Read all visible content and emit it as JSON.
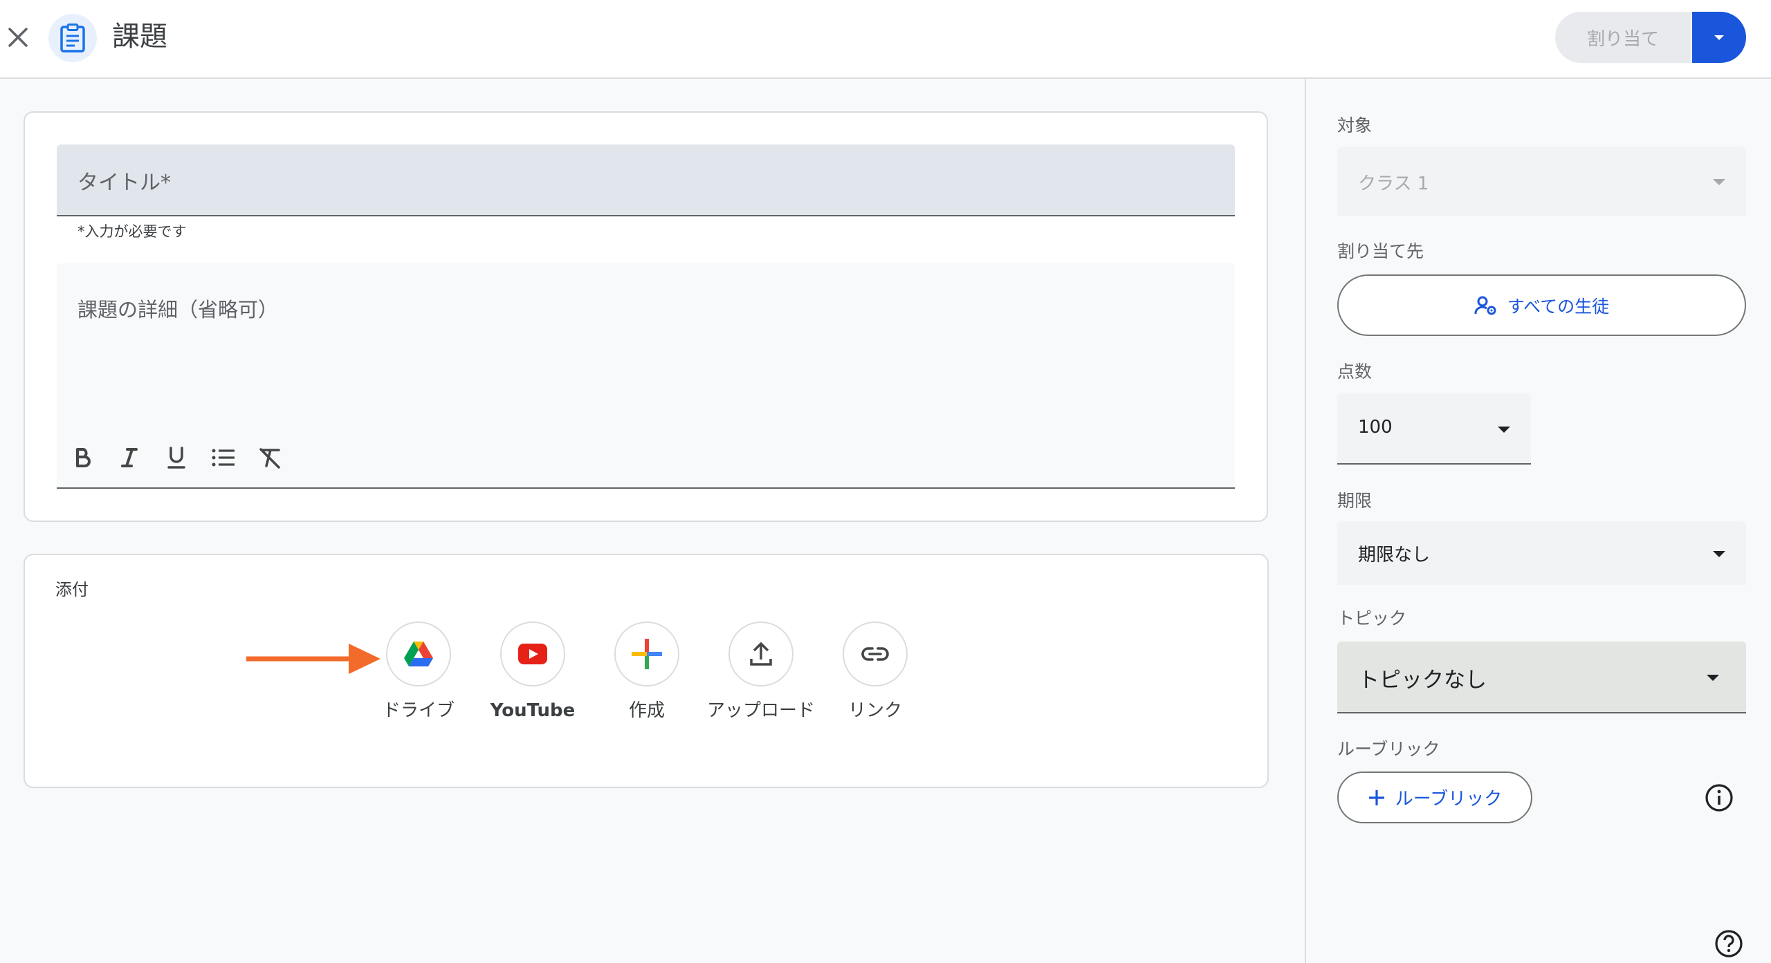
{
  "header": {
    "title": "課題",
    "assign_label": "割り当て"
  },
  "form": {
    "title_placeholder": "タイトル*",
    "required_note": "*入力が必要です",
    "details_placeholder": "課題の詳細（省略可）",
    "toolbar": [
      "bold-icon",
      "italic-icon",
      "underline-icon",
      "bulleted-list-icon",
      "clear-formatting-icon"
    ]
  },
  "attachments": {
    "label": "添付",
    "items": [
      {
        "label": "ドライブ",
        "icon": "google-drive-icon"
      },
      {
        "label": "YouTube",
        "icon": "youtube-icon"
      },
      {
        "label": "作成",
        "icon": "create-plus-icon"
      },
      {
        "label": "アップロード",
        "icon": "upload-icon"
      },
      {
        "label": "リンク",
        "icon": "link-icon"
      }
    ]
  },
  "sidebar": {
    "for_label": "対象",
    "class_value": "クラス 1",
    "assign_to_label": "割り当て先",
    "students_label": "すべての生徒",
    "points_label": "点数",
    "points_value": "100",
    "due_label": "期限",
    "due_value": "期限なし",
    "topic_label": "トピック",
    "topic_value": "トピックなし",
    "rubric_label": "ルーブリック",
    "rubric_button": "ルーブリック"
  },
  "colors": {
    "accent": "#1a56db",
    "arrow": "#f26b2a"
  }
}
